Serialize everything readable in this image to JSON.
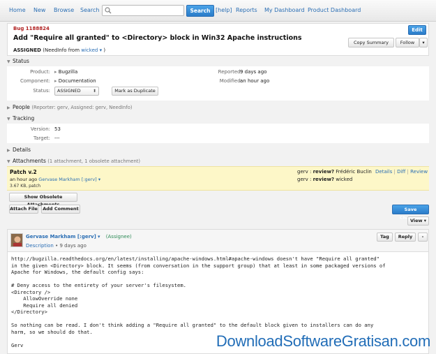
{
  "nav": {
    "home": "Home",
    "new": "New",
    "browse": "Browse",
    "search": "Search",
    "search_placeholder": "",
    "search_button": "Search",
    "help": "[help]",
    "reports": "Reports",
    "my_dashboard": "My Dashboard",
    "product_dashboard": "Product Dashboard"
  },
  "bug": {
    "id": "Bug 1188824",
    "title": "Add \"Require all granted\" to <Directory> block in Win32 Apache instructions",
    "status_word": "ASSIGNED",
    "needinfo_text": "(NeedInfo from",
    "needinfo_user": "wicked",
    "needinfo_close": ")",
    "edit": "Edit",
    "copy_summary": "Copy Summary",
    "follow": "Follow",
    "menu": "▾"
  },
  "status_section": {
    "title": "Status",
    "product_label": "Product:",
    "product_value": "Bugzilla",
    "component_label": "Component:",
    "component_value": "Documentation",
    "status_label": "Status:",
    "status_value": "ASSIGNED",
    "duplicate_button": "Mark as Duplicate",
    "reported_label": "Reported:",
    "reported_value": "9 days ago",
    "modified_label": "Modified:",
    "modified_value": "an hour ago"
  },
  "people": {
    "title": "People",
    "summary": "(Reporter: gerv, Assigned: gerv, NeedInfo)"
  },
  "tracking": {
    "title": "Tracking",
    "version_label": "Version:",
    "version_value": "53",
    "target_label": "Target:",
    "target_value": "---"
  },
  "details": {
    "title": "Details"
  },
  "attachments": {
    "title": "Attachments",
    "summary": "(1 attachment, 1 obsolete attachment)",
    "name": "Patch v.2",
    "time": "an hour ago",
    "author": "Gervase Markham [:gerv]",
    "size": "3.67 KB, patch",
    "flag1_user": "gerv :",
    "flag1_flag": "review?",
    "flag1_target": "Frédéric Buclin",
    "flag2_user": "gerv :",
    "flag2_flag": "review?",
    "flag2_target": "wicked",
    "link_details": "Details",
    "link_diff": "Diff",
    "link_review": "Review",
    "sep": "|",
    "show_obsolete": "Show Obsolete Attachments",
    "attach_file": "Attach File",
    "add_comment": "Add Comment",
    "save_changes": "Save Changes",
    "view": "View ▾"
  },
  "comment": {
    "author": "Gervase Markham [:gerv]",
    "assignee_tag": "(Assignee)",
    "desc_link": "Description",
    "time": "• 9 days ago",
    "tag_button": "Tag",
    "reply_button": "Reply",
    "minus_button": "-",
    "body": "http://bugzilla.readthedocs.org/en/latest/installing/apache-windows.html#apache-windows doesn't have \"Require all granted\"\nin the given <Directory> block. It seems (from conversation in the support group) that at least in some packaged versions of\nApache for Windows, the default config says:\n\n# Deny access to the entirety of your server's filesystem.\n<Directory />\n    AllowOverride none\n    Require all denied\n</Directory>\n\nSo nothing can be read. I don't think adding a \"Require all granted\" to the default block given to installers can do any\nharm, so we should do that.\n\nGerv"
  },
  "watermark": "DownloadSoftwareGratisan.com"
}
